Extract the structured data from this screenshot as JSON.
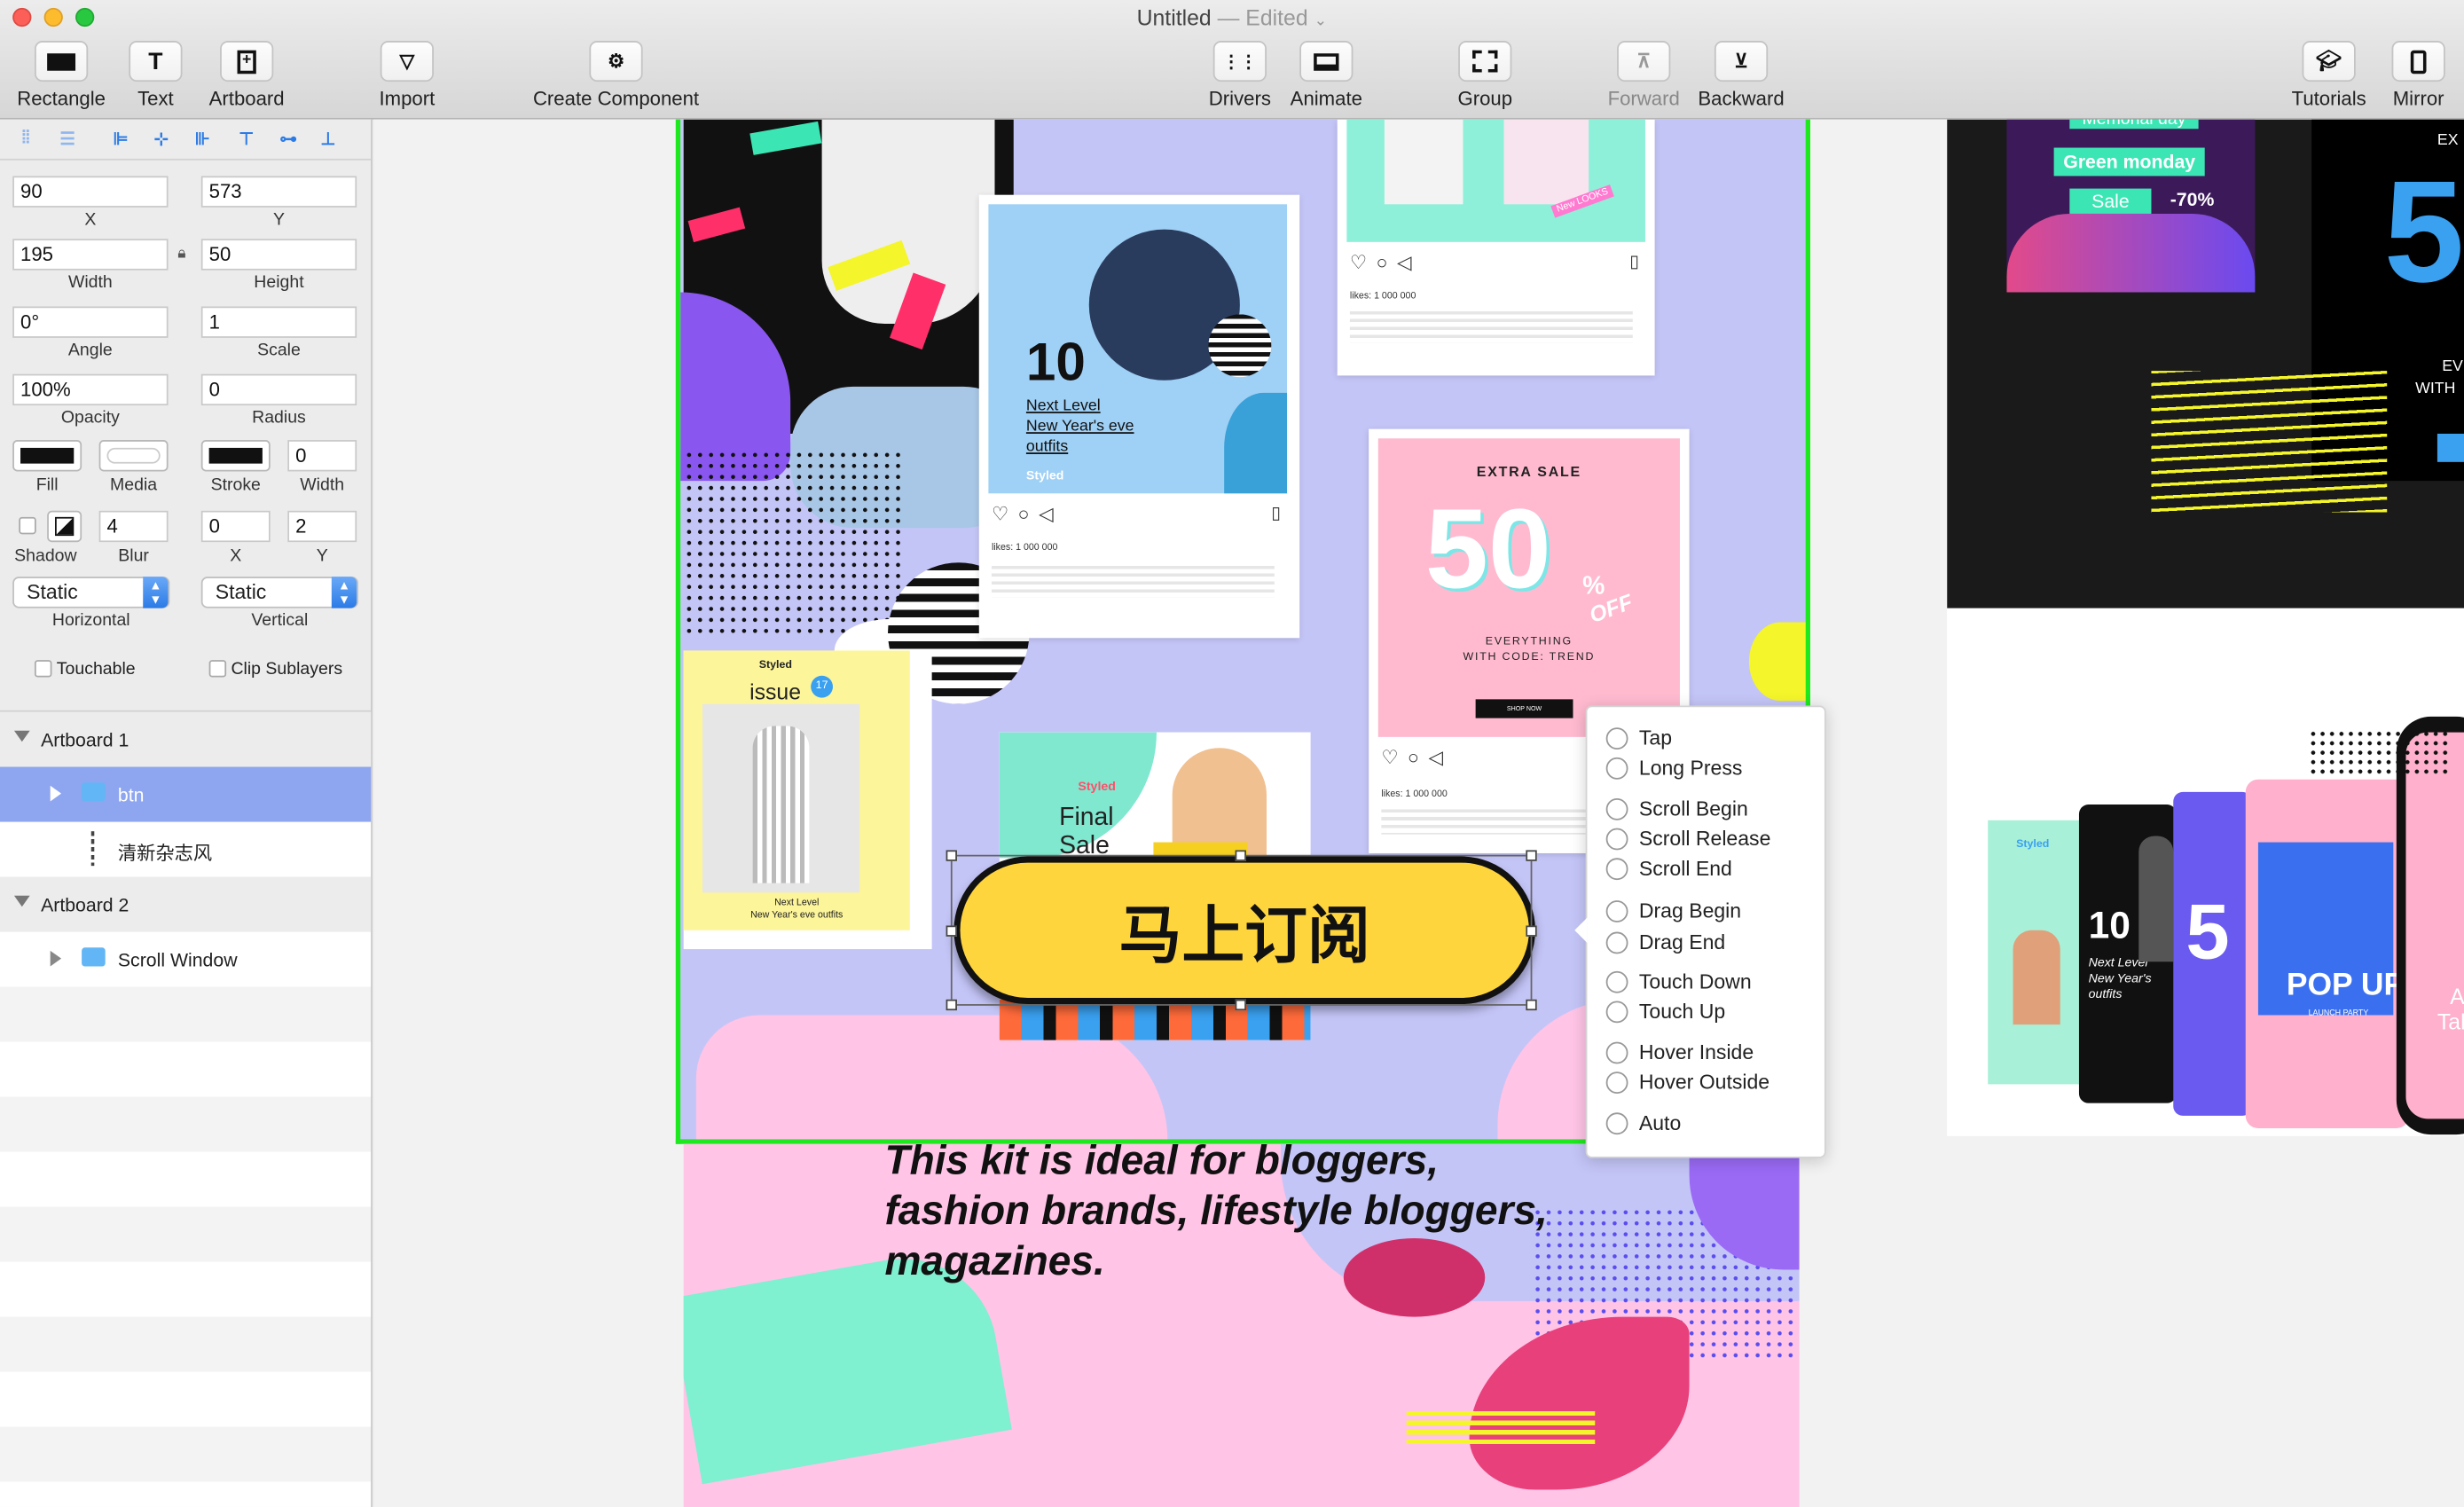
{
  "window": {
    "title": "Untitled",
    "status": "— Edited"
  },
  "colors": {
    "accent": "#2b7be6",
    "selection": "#8ea5f0",
    "artboard_border": "#1ee81e",
    "button_yellow": "#ffd53d"
  },
  "toolbar": {
    "rectangle": "Rectangle",
    "text": "Text",
    "artboard": "Artboard",
    "import": "Import",
    "create_component": "Create Component",
    "drivers": "Drivers",
    "animate": "Animate",
    "group": "Group",
    "forward": "Forward",
    "backward": "Backward",
    "tutorials": "Tutorials",
    "mirror": "Mirror"
  },
  "inspector": {
    "x": {
      "value": "90",
      "label": "X"
    },
    "y": {
      "value": "573",
      "label": "Y"
    },
    "width": {
      "value": "195",
      "label": "Width"
    },
    "height": {
      "value": "50",
      "label": "Height"
    },
    "angle": {
      "value": "0°",
      "label": "Angle"
    },
    "scale": {
      "value": "1",
      "label": "Scale"
    },
    "opacity": {
      "value": "100%",
      "label": "Opacity"
    },
    "radius": {
      "value": "0",
      "label": "Radius"
    },
    "fill_label": "Fill",
    "media_label": "Media",
    "stroke_label": "Stroke",
    "stroke_width": {
      "value": "0",
      "label": "Width"
    },
    "shadow_label": "Shadow",
    "blur": {
      "value": "4",
      "label": "Blur"
    },
    "shadow_x": {
      "value": "0",
      "label": "X"
    },
    "shadow_y": {
      "value": "2",
      "label": "Y"
    },
    "horizontal": {
      "value": "Static",
      "label": "Horizontal"
    },
    "vertical": {
      "value": "Static",
      "label": "Vertical"
    },
    "touchable": "Touchable",
    "clip_sublayers": "Clip Sublayers"
  },
  "layers": [
    {
      "name": "Artboard 1",
      "kind": "artboard"
    },
    {
      "name": "btn",
      "kind": "folder",
      "selected": true
    },
    {
      "name": "清新杂志风",
      "kind": "layer"
    },
    {
      "name": "Artboard 2",
      "kind": "artboard"
    },
    {
      "name": "Scroll Window",
      "kind": "folder"
    }
  ],
  "canvas": {
    "button_text": "马上订阅",
    "ig_post1": {
      "number": "10",
      "line1": "Next Level",
      "line2": "New Year's eve",
      "line3": "outfits",
      "brand": "Styled",
      "likes": "likes: 1 000 000"
    },
    "ig_post2": {
      "likes": "likes: 1 000 000",
      "tag": "New LOOKS"
    },
    "sale_post": {
      "heading": "EXTRA SALE",
      "big": "50",
      "pct": "%",
      "off": "OFF",
      "sub1": "EVERYTHING",
      "sub2": "WITH CODE: TREND",
      "btn": "SHOP NOW",
      "likes": "likes: 1 000 000"
    },
    "issue_post": {
      "brand": "Styled",
      "issue": "issue",
      "num": "17",
      "cap1": "Next Level",
      "cap2": "New Year's eve outfits"
    },
    "final_post": {
      "brand": "Styled",
      "line1": "Final",
      "line2": "Sale"
    },
    "tagline": "This kit is ideal for bloggers, fashion brands, lifestyle bloggers, magazines.",
    "right_top": {
      "l1": "Memorial day",
      "l2": "Green monday",
      "l3": "Sale",
      "l4": "-70%",
      "big": "5",
      "r1": "EX",
      "r2": "EV",
      "r3": "WITH"
    },
    "right_bottom": {
      "s1": "Styled",
      "s2": "10",
      "s3": "Next Level",
      "s4": "New Year's",
      "s5": "outfits",
      "s6": "POP UP",
      "s7": "LAUNCH PARTY",
      "s8": "5",
      "s9": "A",
      "s10": "Tal"
    }
  },
  "popover": {
    "items": [
      "Tap",
      "Long Press",
      "Scroll Begin",
      "Scroll Release",
      "Scroll End",
      "Drag Begin",
      "Drag End",
      "Touch Down",
      "Touch Up",
      "Hover Inside",
      "Hover Outside",
      "Auto"
    ]
  }
}
